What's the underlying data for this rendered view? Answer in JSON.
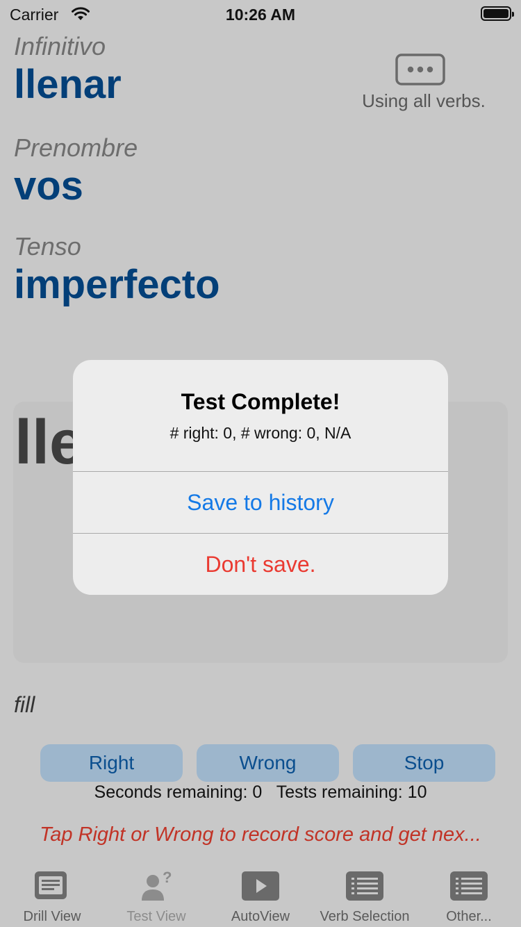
{
  "status_bar": {
    "carrier": "Carrier",
    "time": "10:26 AM"
  },
  "infinitive": {
    "label": "Infinitivo",
    "value": "llenar"
  },
  "pronoun": {
    "label": "Prenombre",
    "value": "vos"
  },
  "tense": {
    "label": "Tenso",
    "value": "imperfecto"
  },
  "verb_filter": {
    "status": "Using all verbs."
  },
  "answer": {
    "partial": "lle"
  },
  "meaning": "fill",
  "buttons": {
    "right": "Right",
    "wrong": "Wrong",
    "stop": "Stop"
  },
  "counters": {
    "text": "Seconds remaining: 0   Tests remaining: 10"
  },
  "hint": "Tap Right or Wrong to record score and get nex...",
  "tabs": [
    {
      "label": "Drill View",
      "icon": "document-icon"
    },
    {
      "label": "Test View",
      "icon": "person-question-icon"
    },
    {
      "label": "AutoView",
      "icon": "play-icon"
    },
    {
      "label": "Verb Selection",
      "icon": "list-icon"
    },
    {
      "label": "Other...",
      "icon": "list-icon"
    }
  ],
  "alert": {
    "title": "Test Complete!",
    "message": "# right: 0, # wrong: 0, N/A",
    "save_label": "Save to history",
    "dont_save_label": "Don't save."
  },
  "colors": {
    "accent_blue": "#033f78",
    "link_blue": "#1479e6",
    "destructive_red": "#ea3a31",
    "hint_red": "#c13326"
  }
}
